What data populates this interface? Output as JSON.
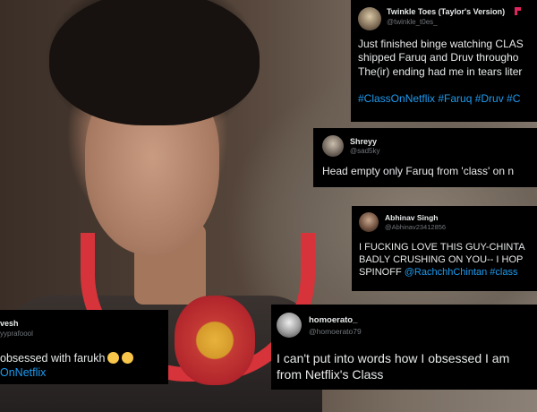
{
  "tweets": [
    {
      "name": "Twinkle Toes (Taylor's Version)",
      "handle": "@twinkle_t0es_",
      "text": "Just finished binge watching CLAS\nshipped Faruq and Druv througho\nThe(ir) ending had me in tears liter",
      "hashtags": "#ClassOnNetflix #Faruq #Druv #C"
    },
    {
      "name": "Shreyy",
      "handle": "@sad5ky",
      "text": "Head empty only Faruq from 'class' on n"
    },
    {
      "name": "Abhinav Singh",
      "handle": "@Abhinav23412856",
      "text_line1": "I FUCKING LOVE THIS GUY-CHINTA",
      "text_line2": "BADLY CRUSHING ON YOU-- I HOP",
      "text_line3_start": "SPINOFF ",
      "text_line3_links": "@RachchhChintan #class"
    },
    {
      "name": "vesh",
      "handle": "yyprafoool",
      "text": "obsessed with farukh",
      "hashtag": "OnNetflix"
    },
    {
      "name": "homoerato_",
      "handle": "@homoerato79",
      "text": "I can't put into words how I obsessed I am\nfrom Netflix's Class"
    }
  ],
  "colors": {
    "link": "#1d9bf0",
    "tweet_bg": "#000000",
    "handle": "#71767b",
    "headphones": "#d7333a"
  },
  "icons": {
    "tweet4_emojis": [
      "tired-face-emoji-icon",
      "rolling-eyes-emoji-icon"
    ],
    "tweet1_flag": "red-flag-icon"
  }
}
